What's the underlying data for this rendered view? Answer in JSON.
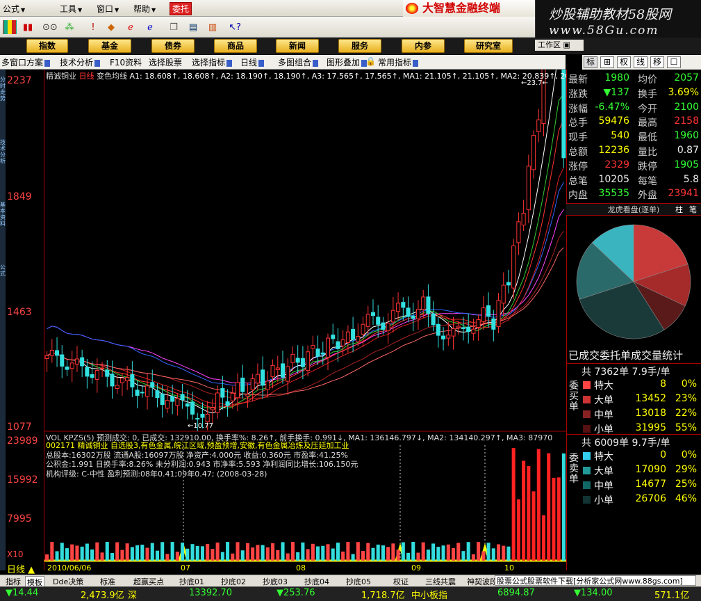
{
  "menu": {
    "items": [
      "公式",
      "工具",
      "窗口",
      "帮助"
    ],
    "weituo": "委托",
    "brand": "大智慧金融终端"
  },
  "watermark": {
    "line1": "炒股辅助教材58股网",
    "line2": "www.58Gu.com"
  },
  "nav": {
    "buttons": [
      "指数",
      "基金",
      "债券",
      "商品",
      "新闻",
      "服务",
      "内参",
      "研究室"
    ],
    "workarea": "工作区"
  },
  "funcbar": {
    "items": [
      "多窗口方案",
      "技术分析",
      "F10资料",
      "选择股票",
      "选择指标",
      "日线",
      "多图组合",
      "图形叠加",
      "常用指标"
    ]
  },
  "rtabs": [
    "标",
    "⊞",
    "权",
    "线",
    "移",
    "☐"
  ],
  "leftstrip": [
    "分时走势",
    "技术分析",
    "基本资料",
    "公式"
  ],
  "chart": {
    "stock_name": "精诚铜业",
    "period": "日线",
    "indicator": "变色均线",
    "ma_text": "A1: 18.608↑, 18.608↑, A2: 18.190↑, 18.190↑, A3: 17.565↑, 17.565↑, MA1: 21.105↑, 21.105↑, MA2: 20.839↑, 20.8",
    "y_labels": [
      "2237",
      "1849",
      "1463",
      "1077"
    ],
    "low_label": "←10.77",
    "high_label": "←23.7←"
  },
  "volume": {
    "title": "VOL KPZS(5) 预测成交: 0, 已成交: 132910.00, 换手率%: 8.26↑, 前手换手: 0.991↓, MA1: 136146.797↓, MA2: 134140.297↑, MA3: 87970",
    "y_labels": [
      "23989",
      "15992",
      "7995",
      "X10"
    ],
    "date_labels": [
      "2010/06/06",
      "07",
      "08",
      "09",
      "10"
    ]
  },
  "info_lines": [
    "002171 精诚铜业 自选股3,有色金属,皖江区域,预盈预增,安徽,有色金属冶炼及压延加工业",
    "总股本:16302万股 流通A股:16097万股 净资产:4.000元 收益:0.360元 市盈率:41.25%",
    "公积金:1.991 日换手率:8.26% 未分利润:0.943 市净率:5.593 净利润同比增长:106.150元",
    "机构评级: C-中性 盈利预测:08年0.41;09年0.47; (2008-03-28)"
  ],
  "quote": {
    "rows": [
      {
        "l1": "最新",
        "v1": "1980",
        "c1": "green",
        "l2": "均价",
        "v2": "2057",
        "c2": "green"
      },
      {
        "l1": "涨跌",
        "v1": "▼137",
        "c1": "green",
        "l2": "换手",
        "v2": "3.69%",
        "c2": "yellow"
      },
      {
        "l1": "涨幅",
        "v1": "-6.47%",
        "c1": "green",
        "l2": "今开",
        "v2": "2100",
        "c2": "green"
      },
      {
        "l1": "总手",
        "v1": "59476",
        "c1": "yellow",
        "l2": "最高",
        "v2": "2158",
        "c2": "red"
      },
      {
        "l1": "现手",
        "v1": "540",
        "c1": "yellow",
        "l2": "最低",
        "v2": "1960",
        "c2": "green"
      },
      {
        "l1": "总额",
        "v1": "12236",
        "c1": "yellow",
        "l2": "量比",
        "v2": "0.87",
        "c2": "white"
      },
      {
        "l1": "涨停",
        "v1": "2329",
        "c1": "red",
        "l2": "跌停",
        "v2": "1905",
        "c2": "green"
      },
      {
        "l1": "总笔",
        "v1": "10205",
        "c1": "white",
        "l2": "每笔",
        "v2": "5.8",
        "c2": "white"
      },
      {
        "l1": "内盘",
        "v1": "35535",
        "c1": "green",
        "l2": "外盘",
        "v2": "23941",
        "c2": "red"
      }
    ],
    "lhk": "龙虎看盘(逐单)",
    "lhk_tabs": [
      "柱",
      "笔"
    ]
  },
  "pie": {
    "title": "已成交委托单成交量统计",
    "slices": [
      0.2,
      0.12,
      0.09,
      0.29,
      0.17,
      0.13
    ],
    "colors": [
      "#c83a3a",
      "#a52a2a",
      "#5a1a1a",
      "#1a3a3a",
      "#2a6a6a",
      "#3ab5c0"
    ]
  },
  "buy": {
    "label": "委买单",
    "summary": "共 7362单 7.9手/单",
    "rows": [
      {
        "name": "特大",
        "vol": "8",
        "pct": "0%",
        "color": "#f44"
      },
      {
        "name": "大单",
        "vol": "13452",
        "pct": "23%",
        "color": "#c33"
      },
      {
        "name": "中单",
        "vol": "13018",
        "pct": "22%",
        "color": "#822"
      },
      {
        "name": "小单",
        "vol": "31995",
        "pct": "55%",
        "color": "#511"
      }
    ]
  },
  "sell": {
    "label": "委卖单",
    "summary": "共 6009单 9.7手/单",
    "rows": [
      {
        "name": "特大",
        "vol": "0",
        "pct": "0%",
        "color": "#3ce"
      },
      {
        "name": "大单",
        "vol": "17090",
        "pct": "29%",
        "color": "#299"
      },
      {
        "name": "中单",
        "vol": "14677",
        "pct": "25%",
        "color": "#166"
      },
      {
        "name": "小单",
        "vol": "26706",
        "pct": "46%",
        "color": "#133"
      }
    ]
  },
  "bottom_tabs": [
    "指标",
    "模板",
    "Dde决策",
    "标准",
    "超赢买点",
    "抄底01",
    "抄底02",
    "抄底03",
    "抄底04",
    "抄底05",
    "权证",
    "三线共震",
    "神契波段"
  ],
  "period_label": "日线",
  "adline": "股票公式股票软件下载[分析家公式网www.88gs.com]",
  "status": {
    "idx1": "▼14.44",
    "amt1": "2,473.9亿",
    "mkt1": "深",
    "idx2": "13392.70",
    "chg2": "▼253.76",
    "amt2": "1,718.7亿",
    "mkt2": "中小板指",
    "idx3": "6894.87",
    "chg3": "▼134.00",
    "amt3": "571.1亿"
  },
  "colors": {
    "up": "#ff3333",
    "down": "#33e0e0",
    "ma_short": "#ffffff",
    "ma_mid": "#ffff00",
    "frame": "#aa0000"
  }
}
